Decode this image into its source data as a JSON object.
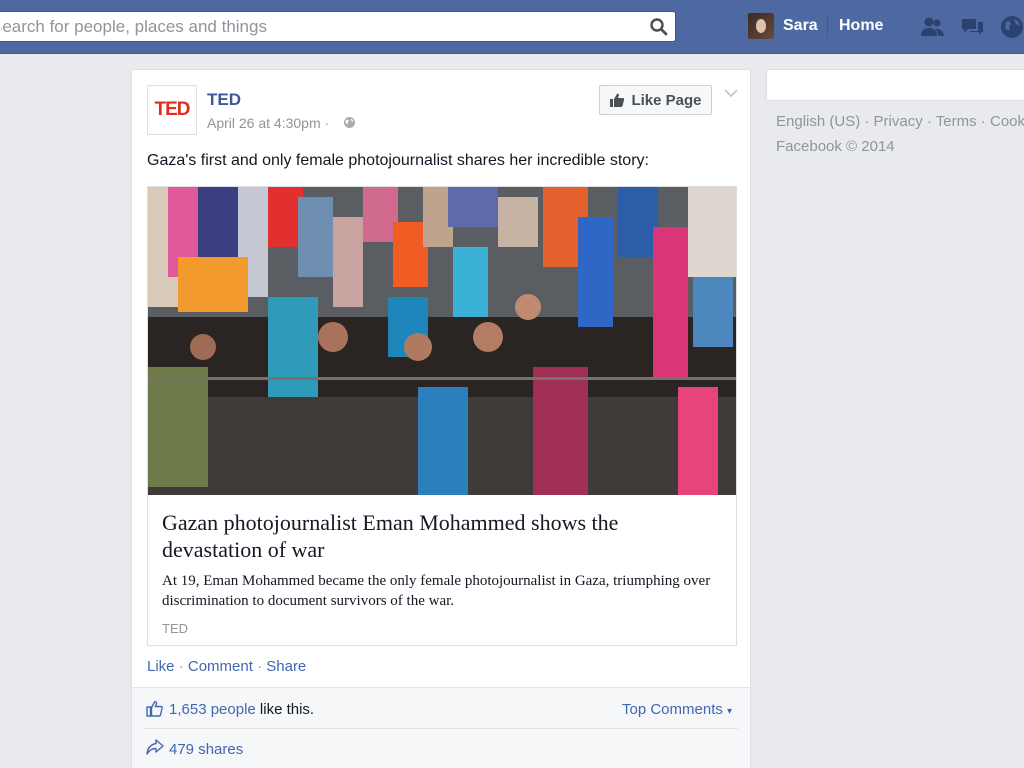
{
  "topbar": {
    "search_placeholder": "Search for people, places and things",
    "user_name": "Sara",
    "home_label": "Home"
  },
  "post": {
    "page_name": "TED",
    "logo_text": "TED",
    "time": "April 26 at 4:30pm · ",
    "text": "Gaza's first and only female photojournalist shares her incredible story:",
    "like_page_label": "Like Page",
    "link": {
      "title": "Gazan photojournalist Eman Mohammed shows the devastation of war",
      "description": "At 19, Eman Mohammed became the only female photojournalist in Gaza, triumphing over discrimination to document survivors of the war.",
      "source": "TED"
    },
    "actions": {
      "like": "Like",
      "comment": "Comment",
      "share": "Share",
      "sep": " · "
    },
    "likes": {
      "count_text": "1,653 people",
      "suffix": " like this."
    },
    "top_comments": "Top Comments",
    "shares": "479 shares"
  },
  "sidebar": {
    "links": [
      "English (US)",
      "Privacy",
      "Terms",
      "Cookies"
    ],
    "sep": " · ",
    "copyright": "Facebook © 2014"
  },
  "colors": {
    "topbar": "#4e69a2",
    "link": "#4267b2",
    "ted_red": "#e62b1e"
  }
}
